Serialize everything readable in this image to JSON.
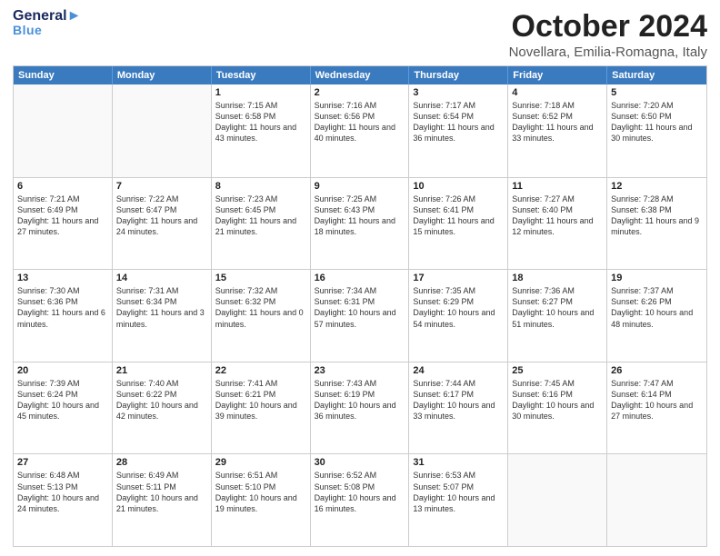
{
  "header": {
    "logo_line1_black": "General",
    "logo_line1_blue": "",
    "logo_line2": "Blue",
    "title": "October 2024",
    "subtitle": "Novellara, Emilia-Romagna, Italy"
  },
  "weekdays": [
    "Sunday",
    "Monday",
    "Tuesday",
    "Wednesday",
    "Thursday",
    "Friday",
    "Saturday"
  ],
  "weeks": [
    [
      {
        "day": "",
        "sunrise": "",
        "sunset": "",
        "daylight": ""
      },
      {
        "day": "",
        "sunrise": "",
        "sunset": "",
        "daylight": ""
      },
      {
        "day": "1",
        "sunrise": "Sunrise: 7:15 AM",
        "sunset": "Sunset: 6:58 PM",
        "daylight": "Daylight: 11 hours and 43 minutes."
      },
      {
        "day": "2",
        "sunrise": "Sunrise: 7:16 AM",
        "sunset": "Sunset: 6:56 PM",
        "daylight": "Daylight: 11 hours and 40 minutes."
      },
      {
        "day": "3",
        "sunrise": "Sunrise: 7:17 AM",
        "sunset": "Sunset: 6:54 PM",
        "daylight": "Daylight: 11 hours and 36 minutes."
      },
      {
        "day": "4",
        "sunrise": "Sunrise: 7:18 AM",
        "sunset": "Sunset: 6:52 PM",
        "daylight": "Daylight: 11 hours and 33 minutes."
      },
      {
        "day": "5",
        "sunrise": "Sunrise: 7:20 AM",
        "sunset": "Sunset: 6:50 PM",
        "daylight": "Daylight: 11 hours and 30 minutes."
      }
    ],
    [
      {
        "day": "6",
        "sunrise": "Sunrise: 7:21 AM",
        "sunset": "Sunset: 6:49 PM",
        "daylight": "Daylight: 11 hours and 27 minutes."
      },
      {
        "day": "7",
        "sunrise": "Sunrise: 7:22 AM",
        "sunset": "Sunset: 6:47 PM",
        "daylight": "Daylight: 11 hours and 24 minutes."
      },
      {
        "day": "8",
        "sunrise": "Sunrise: 7:23 AM",
        "sunset": "Sunset: 6:45 PM",
        "daylight": "Daylight: 11 hours and 21 minutes."
      },
      {
        "day": "9",
        "sunrise": "Sunrise: 7:25 AM",
        "sunset": "Sunset: 6:43 PM",
        "daylight": "Daylight: 11 hours and 18 minutes."
      },
      {
        "day": "10",
        "sunrise": "Sunrise: 7:26 AM",
        "sunset": "Sunset: 6:41 PM",
        "daylight": "Daylight: 11 hours and 15 minutes."
      },
      {
        "day": "11",
        "sunrise": "Sunrise: 7:27 AM",
        "sunset": "Sunset: 6:40 PM",
        "daylight": "Daylight: 11 hours and 12 minutes."
      },
      {
        "day": "12",
        "sunrise": "Sunrise: 7:28 AM",
        "sunset": "Sunset: 6:38 PM",
        "daylight": "Daylight: 11 hours and 9 minutes."
      }
    ],
    [
      {
        "day": "13",
        "sunrise": "Sunrise: 7:30 AM",
        "sunset": "Sunset: 6:36 PM",
        "daylight": "Daylight: 11 hours and 6 minutes."
      },
      {
        "day": "14",
        "sunrise": "Sunrise: 7:31 AM",
        "sunset": "Sunset: 6:34 PM",
        "daylight": "Daylight: 11 hours and 3 minutes."
      },
      {
        "day": "15",
        "sunrise": "Sunrise: 7:32 AM",
        "sunset": "Sunset: 6:32 PM",
        "daylight": "Daylight: 11 hours and 0 minutes."
      },
      {
        "day": "16",
        "sunrise": "Sunrise: 7:34 AM",
        "sunset": "Sunset: 6:31 PM",
        "daylight": "Daylight: 10 hours and 57 minutes."
      },
      {
        "day": "17",
        "sunrise": "Sunrise: 7:35 AM",
        "sunset": "Sunset: 6:29 PM",
        "daylight": "Daylight: 10 hours and 54 minutes."
      },
      {
        "day": "18",
        "sunrise": "Sunrise: 7:36 AM",
        "sunset": "Sunset: 6:27 PM",
        "daylight": "Daylight: 10 hours and 51 minutes."
      },
      {
        "day": "19",
        "sunrise": "Sunrise: 7:37 AM",
        "sunset": "Sunset: 6:26 PM",
        "daylight": "Daylight: 10 hours and 48 minutes."
      }
    ],
    [
      {
        "day": "20",
        "sunrise": "Sunrise: 7:39 AM",
        "sunset": "Sunset: 6:24 PM",
        "daylight": "Daylight: 10 hours and 45 minutes."
      },
      {
        "day": "21",
        "sunrise": "Sunrise: 7:40 AM",
        "sunset": "Sunset: 6:22 PM",
        "daylight": "Daylight: 10 hours and 42 minutes."
      },
      {
        "day": "22",
        "sunrise": "Sunrise: 7:41 AM",
        "sunset": "Sunset: 6:21 PM",
        "daylight": "Daylight: 10 hours and 39 minutes."
      },
      {
        "day": "23",
        "sunrise": "Sunrise: 7:43 AM",
        "sunset": "Sunset: 6:19 PM",
        "daylight": "Daylight: 10 hours and 36 minutes."
      },
      {
        "day": "24",
        "sunrise": "Sunrise: 7:44 AM",
        "sunset": "Sunset: 6:17 PM",
        "daylight": "Daylight: 10 hours and 33 minutes."
      },
      {
        "day": "25",
        "sunrise": "Sunrise: 7:45 AM",
        "sunset": "Sunset: 6:16 PM",
        "daylight": "Daylight: 10 hours and 30 minutes."
      },
      {
        "day": "26",
        "sunrise": "Sunrise: 7:47 AM",
        "sunset": "Sunset: 6:14 PM",
        "daylight": "Daylight: 10 hours and 27 minutes."
      }
    ],
    [
      {
        "day": "27",
        "sunrise": "Sunrise: 6:48 AM",
        "sunset": "Sunset: 5:13 PM",
        "daylight": "Daylight: 10 hours and 24 minutes."
      },
      {
        "day": "28",
        "sunrise": "Sunrise: 6:49 AM",
        "sunset": "Sunset: 5:11 PM",
        "daylight": "Daylight: 10 hours and 21 minutes."
      },
      {
        "day": "29",
        "sunrise": "Sunrise: 6:51 AM",
        "sunset": "Sunset: 5:10 PM",
        "daylight": "Daylight: 10 hours and 19 minutes."
      },
      {
        "day": "30",
        "sunrise": "Sunrise: 6:52 AM",
        "sunset": "Sunset: 5:08 PM",
        "daylight": "Daylight: 10 hours and 16 minutes."
      },
      {
        "day": "31",
        "sunrise": "Sunrise: 6:53 AM",
        "sunset": "Sunset: 5:07 PM",
        "daylight": "Daylight: 10 hours and 13 minutes."
      },
      {
        "day": "",
        "sunrise": "",
        "sunset": "",
        "daylight": ""
      },
      {
        "day": "",
        "sunrise": "",
        "sunset": "",
        "daylight": ""
      }
    ]
  ]
}
